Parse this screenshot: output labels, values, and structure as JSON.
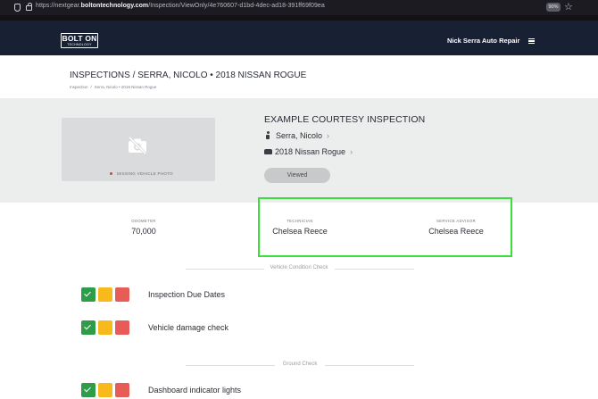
{
  "browser": {
    "url_prefix": "https://nextgear.",
    "url_domain": "boltontechnology.com",
    "url_suffix": "/Inspection/ViewOnly/4e760607-d1bd-4dec-ad18-391ff69f09ea",
    "zoom": "90%"
  },
  "header": {
    "logo_main": "BOLT ON",
    "logo_sub": "TECHNOLOGY",
    "shop_name": "Nick Serra Auto Repair"
  },
  "page": {
    "title": "INSPECTIONS / SERRA, NICOLO • 2018 NISSAN ROGUE",
    "breadcrumb_root": "Inspection",
    "breadcrumb_sep": "/",
    "breadcrumb_current": "Serra, Nicolo • 2018 Nissan Rogue"
  },
  "inspection": {
    "missing_photo": "MISSING VEHICLE PHOTO",
    "title": "EXAMPLE COURTESY INSPECTION",
    "customer": "Serra, Nicolo",
    "vehicle": "2018 Nissan Rogue",
    "status_button": "Viewed"
  },
  "stats": {
    "odometer_label": "ODOMETER",
    "odometer_value": "70,000",
    "technician_label": "TECHNICIAN",
    "technician_value": "Chelsea Reece",
    "advisor_label": "SERVICE ADVISOR",
    "advisor_value": "Chelsea Reece"
  },
  "sections": [
    {
      "label": "Vehicle Condition Check",
      "items": [
        {
          "label": "Inspection Due Dates",
          "status": "green"
        },
        {
          "label": "Vehicle damage check",
          "status": "green"
        }
      ]
    },
    {
      "label": "Ground Check",
      "items": [
        {
          "label": "Dashboard indicator lights",
          "status": "green"
        }
      ]
    }
  ],
  "colors": {
    "header_bg": "#182034",
    "status_green": "#2e9c48",
    "status_yellow": "#f8b91d",
    "status_red": "#e85c58",
    "highlight": "#3cde3c"
  }
}
